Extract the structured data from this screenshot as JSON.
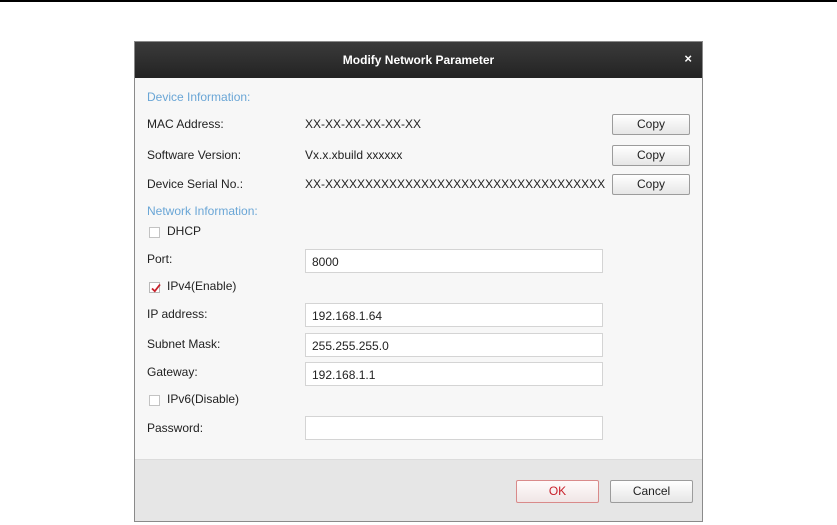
{
  "dialog": {
    "title": "Modify Network Parameter",
    "close_glyph": "×"
  },
  "device_info": {
    "heading": "Device Information:",
    "mac_label": "MAC Address:",
    "mac_value": "XX-XX-XX-XX-XX-XX",
    "software_label": "Software Version:",
    "software_value": "Vx.x.xbuild xxxxxx",
    "serial_label": "Device Serial No.:",
    "serial_value": "XX-XXXXXXXXXXXXXXXXXXXXXXXXXXXXXXXXXXX",
    "copy_label": "Copy"
  },
  "network_info": {
    "heading": "Network Information:",
    "dhcp_label": "DHCP",
    "dhcp_checked": false,
    "port_label": "Port:",
    "port_value": "8000",
    "ipv4_label": "IPv4(Enable)",
    "ipv4_checked": true,
    "ip_label": "IP address:",
    "ip_value": "192.168.1.64",
    "mask_label": "Subnet Mask:",
    "mask_value": "255.255.255.0",
    "gateway_label": "Gateway:",
    "gateway_value": "192.168.1.1",
    "ipv6_label": "IPv6(Disable)",
    "ipv6_checked": false,
    "password_label": "Password:",
    "password_value": ""
  },
  "footer": {
    "ok_label": "OK",
    "cancel_label": "Cancel"
  },
  "colors": {
    "section_heading": "#6aa6d6",
    "titlebar": "#2b2b2b",
    "ok_accent": "#c8202a",
    "check_mark": "#c8202a"
  }
}
